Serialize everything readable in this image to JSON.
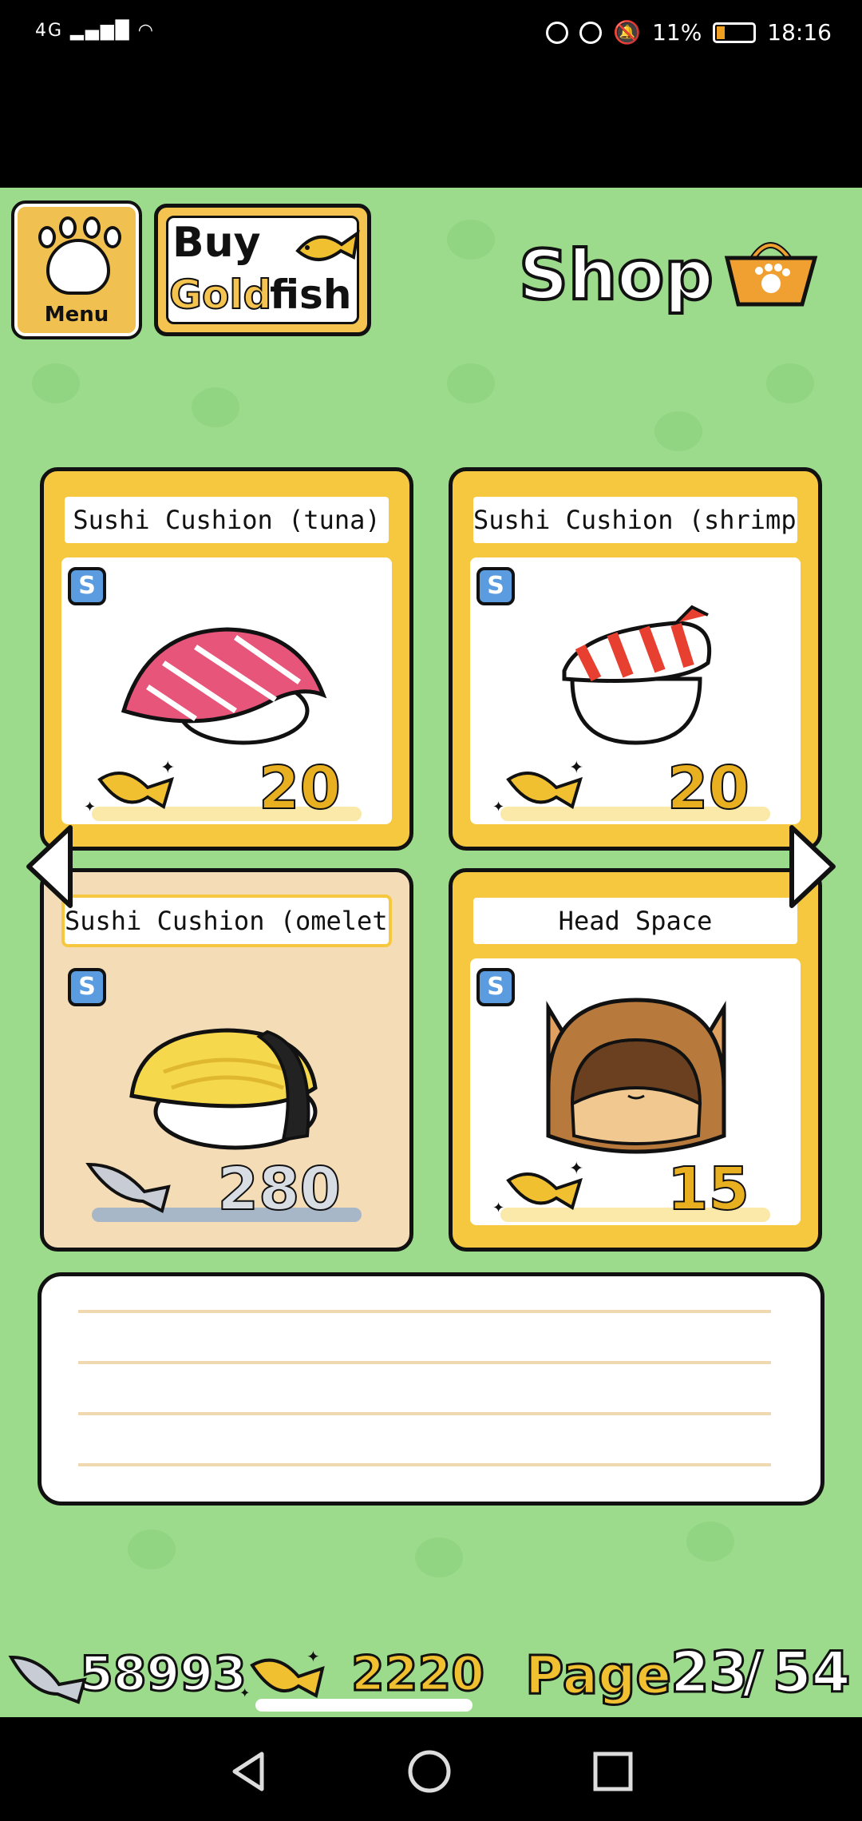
{
  "status_bar": {
    "network": "4G",
    "battery_percent": "11%",
    "time": "18:16"
  },
  "header": {
    "menu_label": "Menu",
    "buy_gold_line1": "Buy",
    "buy_gold_gold": "Gold",
    "buy_gold_fish": "fish",
    "title": "Shop"
  },
  "items": [
    {
      "name": "Sushi Cushion (tuna)",
      "badge": "S",
      "price": "20",
      "currency": "gold-fish"
    },
    {
      "name": "Sushi Cushion (shrimp)",
      "badge": "S",
      "price": "20",
      "currency": "gold-fish"
    },
    {
      "name": "Sushi Cushion (omelet)",
      "badge": "S",
      "price": "280",
      "currency": "silver-fish"
    },
    {
      "name": "Head Space",
      "badge": "S",
      "price": "15",
      "currency": "gold-fish"
    }
  ],
  "footer": {
    "silver_fish_count": "58993",
    "gold_fish_count": "2220",
    "page_label": "Page",
    "page_current": "23",
    "page_separator": "/",
    "page_total": "54"
  },
  "colors": {
    "background": "#9ddb8c",
    "card_yellow": "#f5c840",
    "selected_card": "#f3dcb6",
    "gold": "#e8b020"
  }
}
